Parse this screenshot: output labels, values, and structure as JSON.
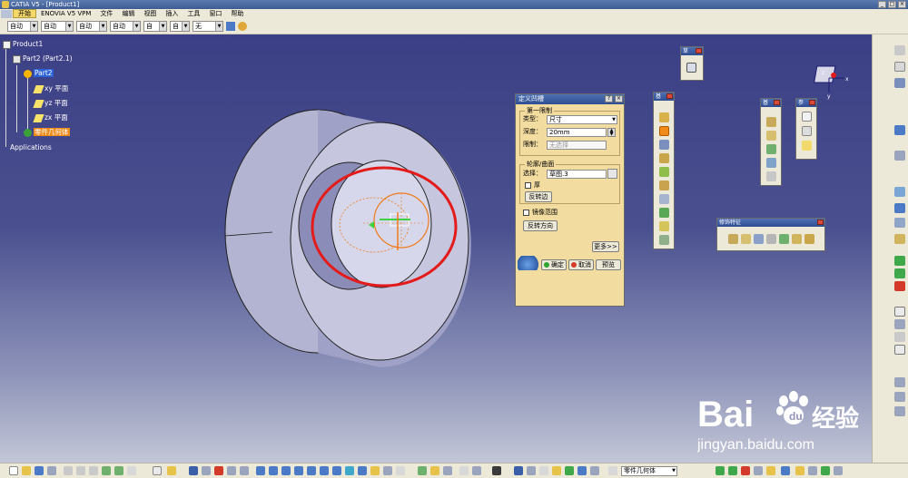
{
  "window": {
    "title": "CATIA V5 - [Product1]",
    "controls": [
      "_",
      "□",
      "×"
    ]
  },
  "menu": {
    "items": [
      "开始",
      "ENOVIA V5 VPM",
      "文件",
      "编辑",
      "视图",
      "插入",
      "工具",
      "窗口",
      "帮助"
    ]
  },
  "properties_toolbar": {
    "combos": [
      "自动",
      "自动",
      "自动",
      "自动",
      "自",
      "自",
      "无"
    ]
  },
  "tree": {
    "product": "Product1",
    "instance": "Part2 (Part2.1)",
    "part": "Part2",
    "planes": [
      "xy 平面",
      "yz 平面",
      "zx 平面"
    ],
    "body": "零件几何体",
    "applications": "Applications"
  },
  "dialog": {
    "title": "定义凹槽",
    "first_limit_label": "第一限制",
    "type_label": "类型：",
    "type_value": "尺寸",
    "depth_label": "深度：",
    "depth_value": "20mm",
    "limit_label": "限制：",
    "limit_value": "无选择",
    "profile_label": "轮廓/曲面",
    "select_label": "选择：",
    "select_value": "草图.3",
    "thick_label": "厚",
    "reverse_side": "反转边",
    "mirror_label": "镜像范围",
    "reverse_dir": "反转方向",
    "more": "更多>>",
    "ok": "确定",
    "cancel": "取消",
    "preview": "预览",
    "help": "?",
    "close": "×"
  },
  "palettes": {
    "sketch": "草",
    "base": "基",
    "ref1": "基",
    "ref2": "参",
    "dress": "修饰特征"
  },
  "bottom_toolbar": {
    "body_combo": "零件几何体"
  },
  "colors": {
    "viewport_top": "#3b3f85",
    "viewport_bottom": "#c3c6d6",
    "dialog_bg": "#f3dca0",
    "selection_highlight": "#e41b1b",
    "preview_orange": "#f07a1a"
  },
  "watermark": {
    "brand_text": "Bai",
    "brand_cn": "经验",
    "url": "jingyan.baidu.com"
  }
}
